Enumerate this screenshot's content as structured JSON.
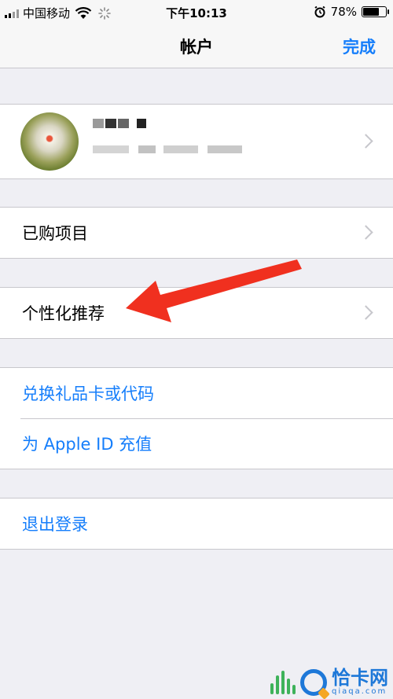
{
  "status": {
    "carrier": "中国移动",
    "time": "下午10:13",
    "battery": "78%",
    "battery_level": 0.78
  },
  "navbar": {
    "title": "帐户",
    "done_label": "完成"
  },
  "menu": {
    "purchased": "已购项目",
    "personalized": "个性化推荐",
    "redeem": "兑换礼品卡或代码",
    "add_funds": "为 Apple ID 充值",
    "sign_out": "退出登录"
  },
  "icons": {
    "signal": "signal-icon",
    "wifi": "wifi-icon",
    "loading": "spinner-icon",
    "alarm": "alarm-icon",
    "battery": "battery-icon",
    "chevron": "chevron-right-icon"
  },
  "colors": {
    "accent": "#157efb",
    "annotation_arrow": "#f0301f"
  },
  "watermark": {
    "name": "恰卡网",
    "domain": "qiaqa.com"
  }
}
